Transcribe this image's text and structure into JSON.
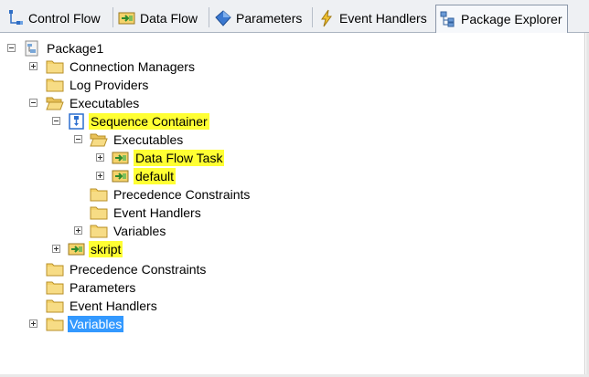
{
  "tabs": [
    {
      "label": "Control Flow",
      "icon": "control-flow-icon"
    },
    {
      "label": "Data Flow",
      "icon": "data-flow-icon"
    },
    {
      "label": "Parameters",
      "icon": "parameters-icon"
    },
    {
      "label": "Event Handlers",
      "icon": "event-handlers-icon"
    },
    {
      "label": "Package Explorer",
      "icon": "package-explorer-icon",
      "active": true
    }
  ],
  "tree": {
    "package": "Package1",
    "root_children": {
      "connection_managers": "Connection Managers",
      "log_providers": "Log Providers",
      "executables": "Executables",
      "precedence_constraints": "Precedence Constraints",
      "parameters": "Parameters",
      "event_handlers": "Event Handlers",
      "variables": "Variables"
    },
    "sequence_container": {
      "label": "Sequence Container",
      "executables": "Executables",
      "data_flow_task": "Data Flow Task",
      "default": "default",
      "precedence_constraints": "Precedence Constraints",
      "event_handlers": "Event Handlers",
      "variables": "Variables"
    },
    "skript": "skript"
  },
  "colors": {
    "highlight": "#ffff33",
    "selection": "#3399ff",
    "folder": "#f2c94c"
  }
}
